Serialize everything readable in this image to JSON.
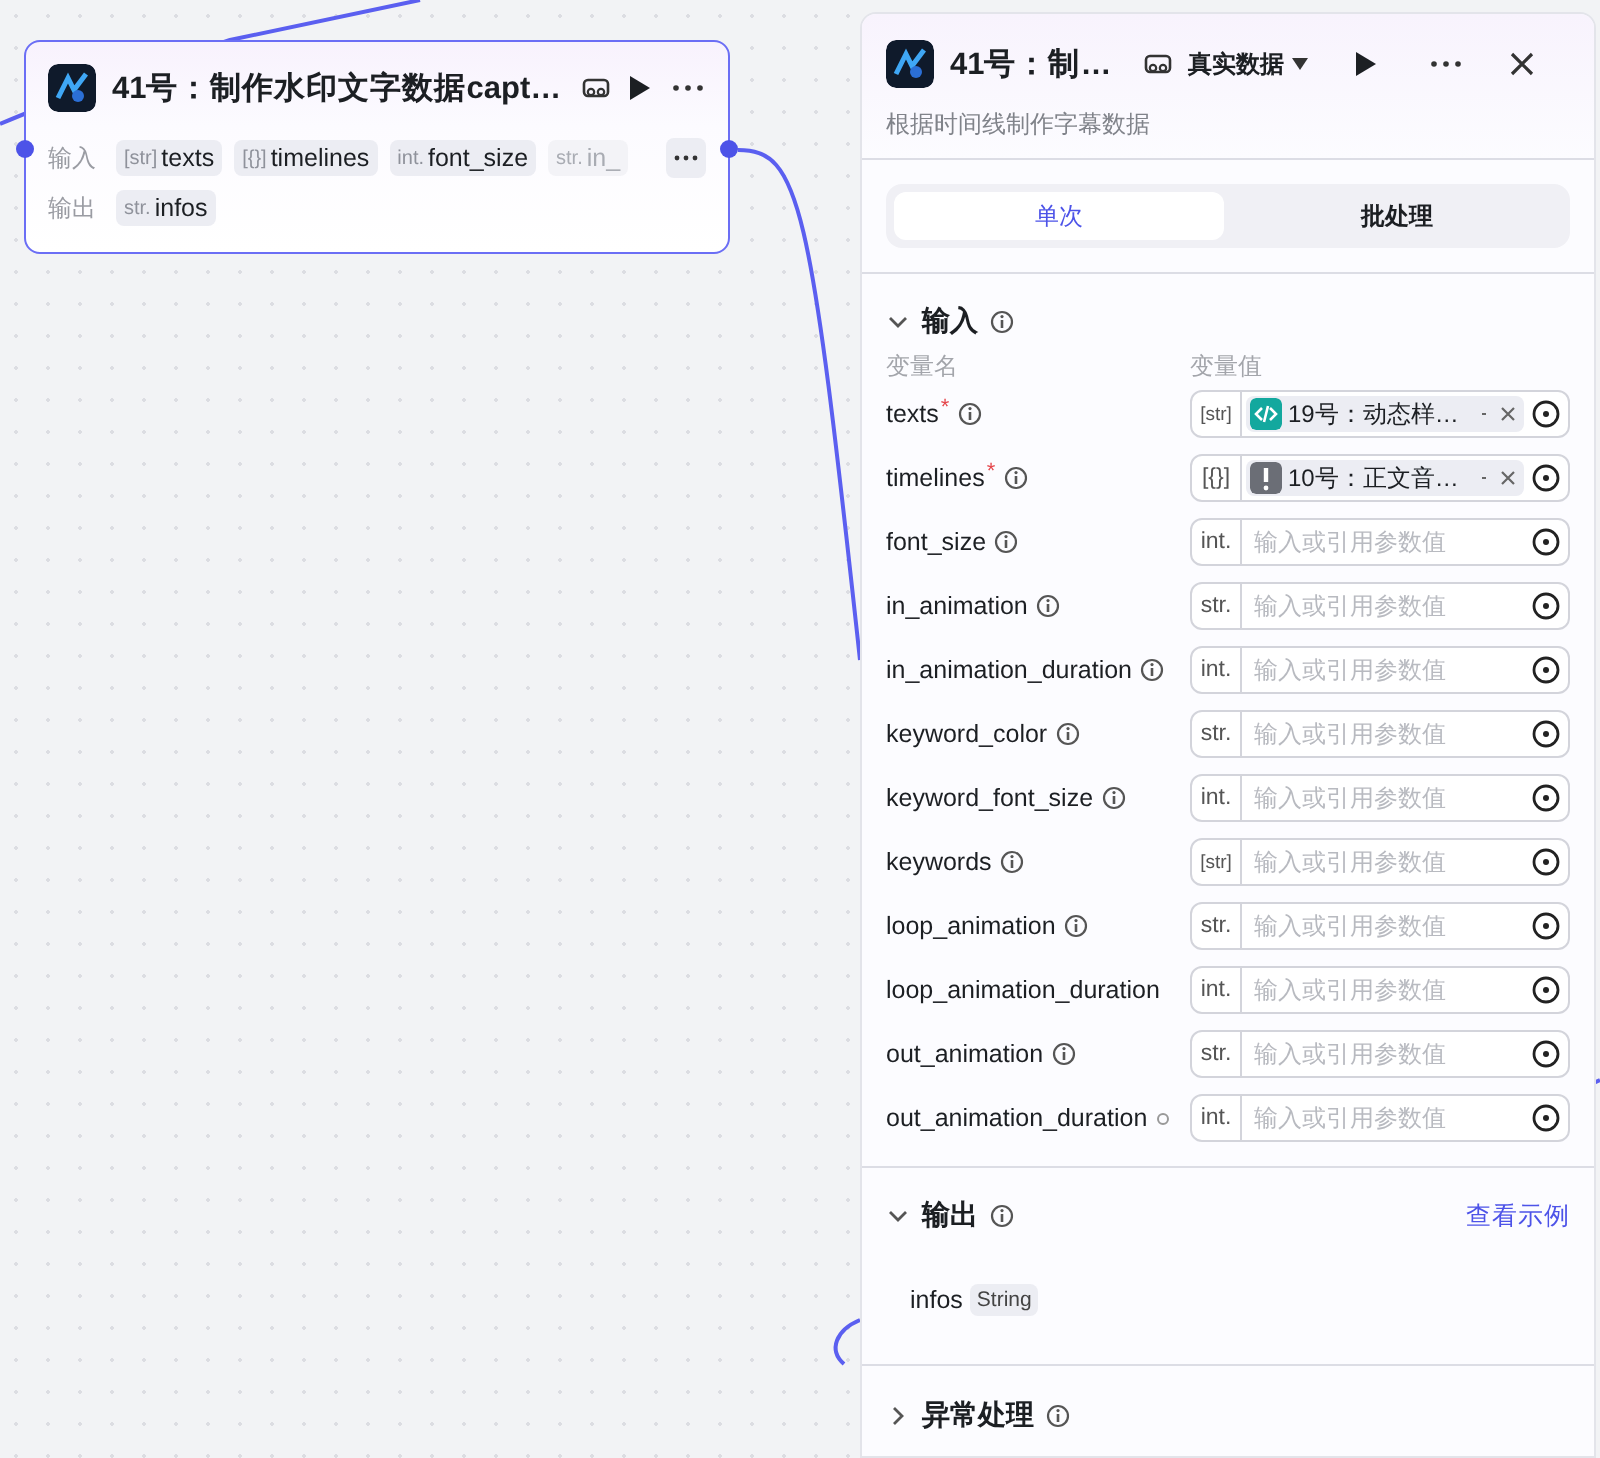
{
  "node": {
    "title": "41号：制作水印文字数据capt…",
    "inputs_label": "输入",
    "inputs": [
      {
        "type": "[str]",
        "name": "texts",
        "faded": false
      },
      {
        "type": "[{}]",
        "name": "timelines",
        "faded": false
      },
      {
        "type": "int.",
        "name": "font_size",
        "faded": false
      },
      {
        "type": "str.",
        "name": "in_",
        "faded": true
      }
    ],
    "outputs_label": "输出",
    "outputs": [
      {
        "type": "str.",
        "name": "infos",
        "faded": false
      }
    ]
  },
  "panel": {
    "title": "41号：制…",
    "data_mode": "真实数据",
    "description": "根据时间线制作字幕数据",
    "tabs": [
      {
        "label": "单次",
        "selected": true
      },
      {
        "label": "批处理",
        "selected": false
      }
    ],
    "input_section": {
      "title": "输入",
      "expanded": true,
      "name_header": "变量名",
      "value_header": "变量值",
      "params": [
        {
          "name": "texts",
          "required_mark": "*",
          "info": true,
          "type": "[str]",
          "value": {
            "kind": "code",
            "label": "19号：动态样…"
          }
        },
        {
          "name": "timelines",
          "required_mark": "*",
          "info": true,
          "type": "[{}]",
          "value": {
            "kind": "warning",
            "label": "10号：正文音…"
          }
        },
        {
          "name": "font_size",
          "info": true,
          "type": "int.",
          "placeholder": "输入或引用参数值"
        },
        {
          "name": "in_animation",
          "info": true,
          "type": "str.",
          "placeholder": "输入或引用参数值"
        },
        {
          "name": "in_animation_duration",
          "info": true,
          "type": "int.",
          "placeholder": "输入或引用参数值"
        },
        {
          "name": "keyword_color",
          "info": true,
          "type": "str.",
          "placeholder": "输入或引用参数值"
        },
        {
          "name": "keyword_font_size",
          "info": true,
          "type": "int.",
          "placeholder": "输入或引用参数值"
        },
        {
          "name": "keywords",
          "info": true,
          "type": "[str]",
          "placeholder": "输入或引用参数值"
        },
        {
          "name": "loop_animation",
          "info": true,
          "type": "str.",
          "placeholder": "输入或引用参数值"
        },
        {
          "name": "loop_animation_duration",
          "info": false,
          "type": "int.",
          "placeholder": "输入或引用参数值"
        },
        {
          "name": "out_animation",
          "info": true,
          "type": "str.",
          "placeholder": "输入或引用参数值"
        },
        {
          "name": "out_animation_duration",
          "info": false,
          "marker": true,
          "type": "int.",
          "placeholder": "输入或引用参数值"
        }
      ]
    },
    "output_section": {
      "title": "输出",
      "expanded": true,
      "link": "查看示例",
      "outputs": [
        {
          "name": "infos",
          "type": "String"
        }
      ]
    },
    "error_section": {
      "title": "异常处理",
      "expanded": false
    }
  }
}
